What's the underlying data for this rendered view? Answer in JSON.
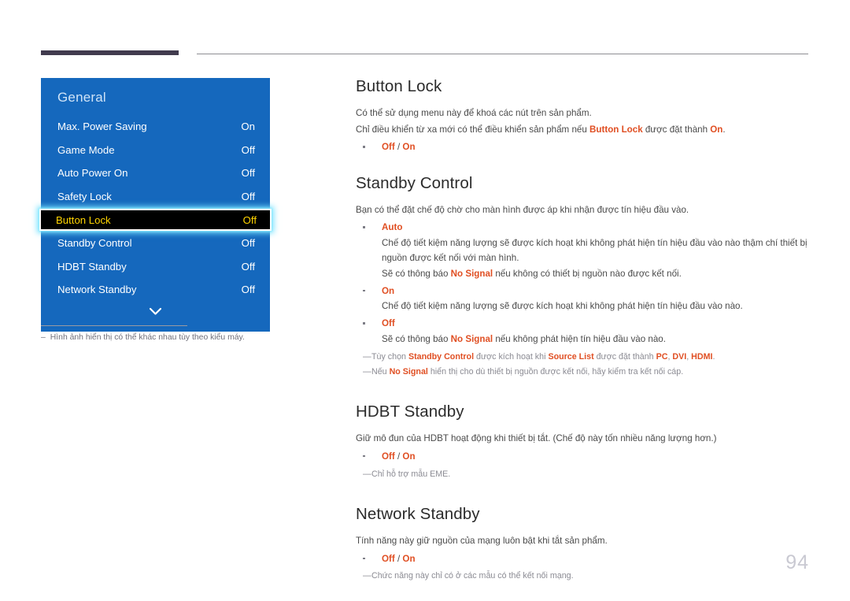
{
  "page": {
    "number": "94"
  },
  "osd": {
    "title": "General",
    "rows": [
      {
        "label": "Max. Power Saving",
        "value": "On",
        "selected": false
      },
      {
        "label": "Game Mode",
        "value": "Off",
        "selected": false
      },
      {
        "label": "Auto Power On",
        "value": "Off",
        "selected": false
      },
      {
        "label": "Safety Lock",
        "value": "Off",
        "selected": false
      },
      {
        "label": "Button Lock",
        "value": "Off",
        "selected": true
      },
      {
        "label": "Standby Control",
        "value": "Off",
        "selected": false
      },
      {
        "label": "HDBT Standby",
        "value": "Off",
        "selected": false
      },
      {
        "label": "Network Standby",
        "value": "Off",
        "selected": false
      }
    ],
    "scroll_icon": "chevron-down-icon",
    "colors": {
      "panel": "#1568bd",
      "selected_bg": "#000000",
      "selected_text": "#ffd400",
      "glow": "#78e4ff"
    }
  },
  "caption": {
    "dash": "–",
    "text": "Hình ảnh hiển thị có thể khác nhau tùy theo kiểu máy."
  },
  "sections": {
    "button_lock": {
      "title": "Button Lock",
      "para1": "Có thể sử dụng menu này để khoá các nút trên sản phẩm.",
      "para2_a": "Chỉ điều khiển từ xa mới có thể điều khiển sản phẩm nếu ",
      "para2_kw1": "Button Lock",
      "para2_b": " được đặt thành ",
      "para2_kw2": "On",
      "para2_c": ".",
      "option_off": "Off",
      "option_sep": " / ",
      "option_on": "On"
    },
    "standby_control": {
      "title": "Standby Control",
      "para1": "Bạn có thể đặt chế độ chờ cho màn hình được áp khi nhận được tín hiệu đầu vào.",
      "item_auto": {
        "label": "Auto",
        "desc": "Chế độ tiết kiệm năng lượng sẽ được kích hoạt khi không phát hiện tín hiệu đầu vào nào thậm chí thiết bị nguồn được kết nối với màn hình.",
        "desc2_a": "Sẽ có thông báo ",
        "desc2_kw": "No Signal",
        "desc2_b": " nếu không có thiết bị nguồn nào được kết nối."
      },
      "item_on": {
        "label": "On",
        "desc": "Chế độ tiết kiệm năng lượng sẽ được kích hoạt khi không phát hiện tín hiệu đầu vào nào."
      },
      "item_off": {
        "label": "Off",
        "desc_a": "Sẽ có thông báo ",
        "desc_kw": "No Signal",
        "desc_b": " nếu không phát hiện tín hiệu đầu vào nào."
      },
      "note1": {
        "dash": "—",
        "a": "Tùy chọn ",
        "kw1": "Standby Control",
        "b": " được kích hoạt khi ",
        "kw2": "Source List",
        "c": " được đặt thành ",
        "kw3": "PC",
        "d": ", ",
        "kw4": "DVI",
        "e": ", ",
        "kw5": "HDMI",
        "f": "."
      },
      "note2": {
        "dash": "—",
        "a": "Nếu ",
        "kw1": "No Signal",
        "b": " hiển thị cho dù thiết bị nguồn được kết nối, hãy kiểm tra kết nối cáp."
      }
    },
    "hdbt_standby": {
      "title": "HDBT Standby",
      "para1": "Giữ mô đun của HDBT hoạt động khi thiết bị tắt. (Chế độ này tốn nhiều năng lượng hơn.)",
      "option_off": "Off",
      "option_sep": " / ",
      "option_on": "On",
      "note": {
        "dash": "—",
        "text": "Chỉ hỗ trợ mẫu EME."
      }
    },
    "network_standby": {
      "title": "Network Standby",
      "para1": "Tính năng này giữ nguồn của mạng luôn bật khi tắt sản phẩm.",
      "option_off": "Off",
      "option_sep": " / ",
      "option_on": "On",
      "note": {
        "dash": "—",
        "text": "Chức năng này chỉ có ở các mẫu có thể kết nối mạng."
      }
    }
  }
}
